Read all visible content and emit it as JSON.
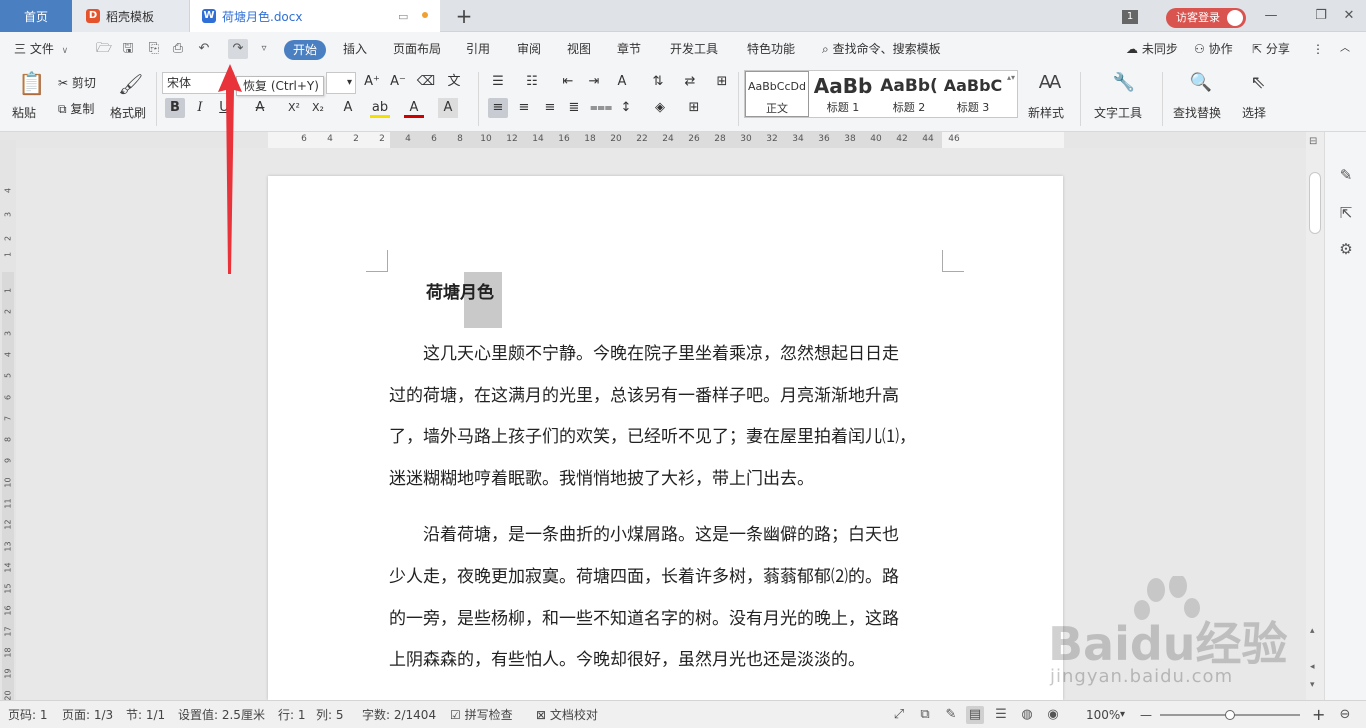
{
  "tabs": {
    "home": "首页",
    "template": "稻壳模板",
    "doc": "荷塘月色.docx",
    "new_tab": "+"
  },
  "window": {
    "count": "1",
    "login": "访客登录",
    "minimize": "—",
    "restore": "❐",
    "close": "✕"
  },
  "menu": {
    "file": "三 文件",
    "items": [
      "开始",
      "插入",
      "页面布局",
      "引用",
      "审阅",
      "视图",
      "章节",
      "开发工具",
      "特色功能"
    ],
    "search": "查找命令、搜索模板",
    "sync": "未同步",
    "collab": "协作",
    "share": "分享"
  },
  "ribbon": {
    "paste": "粘贴",
    "cut": "剪切",
    "copy": "复制",
    "format_painter": "格式刷",
    "font_name": "宋体",
    "font_size": "▾",
    "tooltip": "恢复 (Ctrl+Y)",
    "styles": [
      {
        "preview": "AaBbCcDd",
        "name": "正文"
      },
      {
        "preview": "AaBb",
        "name": "标题 1"
      },
      {
        "preview": "AaBb(",
        "name": "标题 2"
      },
      {
        "preview": "AaBbC",
        "name": "标题 3"
      }
    ],
    "new_style": "新样式",
    "text_tools": "文字工具",
    "find_replace": "查找替换",
    "select": "选择"
  },
  "ruler": {
    "horizontal": [
      "6",
      "4",
      "2",
      "2",
      "4",
      "6",
      "8",
      "10",
      "12",
      "14",
      "16",
      "18",
      "20",
      "22",
      "24",
      "26",
      "28",
      "30",
      "32",
      "34",
      "36",
      "38",
      "40",
      "42",
      "44",
      "46"
    ],
    "vertical": [
      "4",
      "3",
      "2",
      "1",
      "1",
      "2",
      "3",
      "4",
      "5",
      "6",
      "7",
      "8",
      "9",
      "10",
      "11",
      "12",
      "13",
      "14",
      "15",
      "16",
      "17",
      "18",
      "19",
      "20"
    ]
  },
  "document": {
    "title": "荷塘月色",
    "lines": [
      "　　这几天心里颇不宁静。今晚在院子里坐着乘凉，忽然想起日日走",
      "过的荷塘，在这满月的光里，总该另有一番样子吧。月亮渐渐地升高",
      "了，墙外马路上孩子们的欢笑，已经听不见了；妻在屋里拍着闰儿⑴，",
      "迷迷糊糊地哼着眠歌。我悄悄地披了大衫，带上门出去。",
      "　　沿着荷塘，是一条曲折的小煤屑路。这是一条幽僻的路；白天也",
      "少人走，夜晚更加寂寞。荷塘四面，长着许多树，蓊蓊郁郁⑵的。路",
      "的一旁，是些杨柳，和一些不知道名字的树。没有月光的晚上，这路",
      "上阴森森的，有些怕人。今晚却很好，虽然月光也还是淡淡的。"
    ]
  },
  "status": {
    "page": "页码: 1",
    "pages": "页面: 1/3",
    "section": "节: 1/1",
    "setting": "设置值: 2.5厘米",
    "row": "行: 1",
    "col": "列: 5",
    "words": "字数: 2/1404",
    "spell": "拼写检查",
    "proof": "文档校对",
    "zoom": "100%",
    "zoom_fraction": 0.5,
    "minus": "—",
    "plus": "+"
  },
  "watermark": {
    "brand": "Baidu经验",
    "url": "jingyan.baidu.com"
  },
  "colors": {
    "accent": "#4a7fc1",
    "arrow": "#e8333a",
    "login": "#d9534f",
    "wps_word": "#2f6fd6",
    "docer": "#e5532d"
  }
}
